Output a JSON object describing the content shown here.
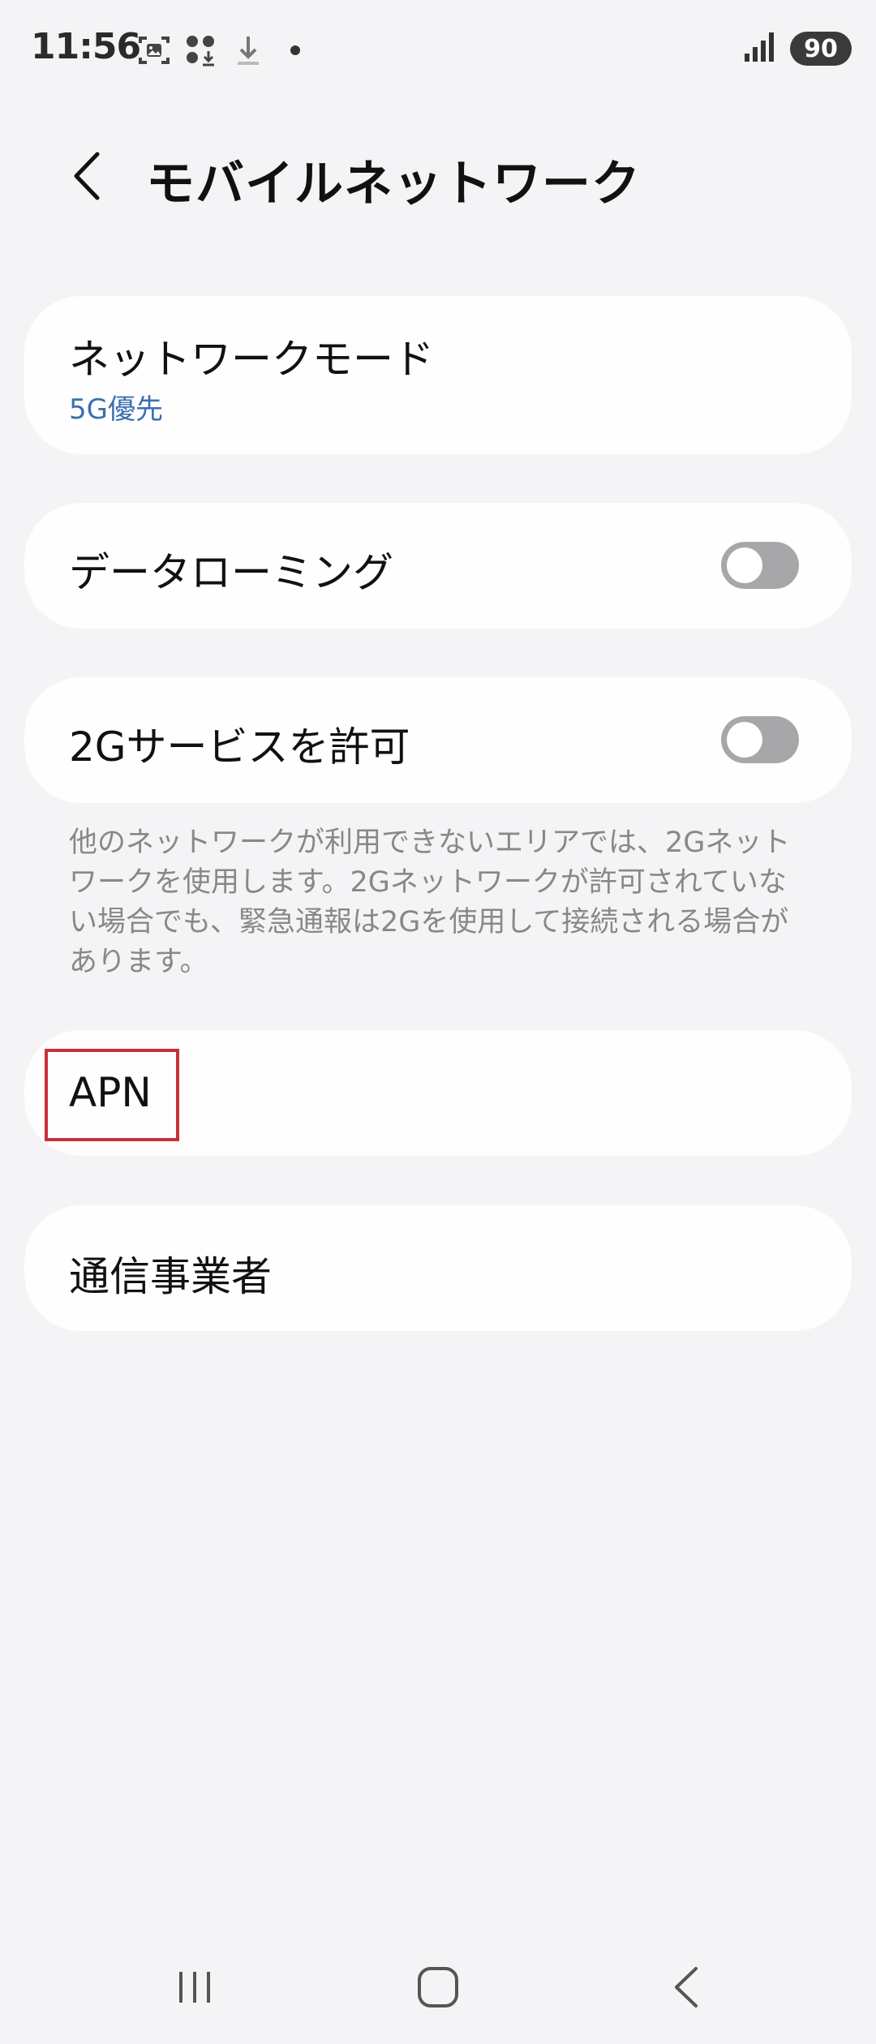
{
  "status_bar": {
    "time": "11:56",
    "battery": "90",
    "icons": [
      "screenshot-icon",
      "apps-download-icon",
      "download-icon",
      "dot-icon",
      "signal-icon",
      "battery-icon"
    ]
  },
  "header": {
    "title": "モバイルネットワーク",
    "back_icon": "chevron-left-icon"
  },
  "settings": {
    "network_mode": {
      "label": "ネットワークモード",
      "value": "5G優先"
    },
    "data_roaming": {
      "label": "データローミング",
      "enabled": false
    },
    "allow_2g": {
      "label": "2Gサービスを許可",
      "enabled": false
    },
    "description": "他のネットワークが利用できないエリアでは、2Gネットワークを使用します。2Gネットワークが許可されていない場合でも、緊急通報は2Gを使用して接続される場合があります。",
    "apn": {
      "label": "APN"
    },
    "carrier": {
      "label": "通信事業者"
    }
  },
  "colors": {
    "background": "#f4f4f6",
    "card": "#fefefe",
    "accent_text": "#3a6fb0",
    "toggle_off": "#a7a7a9",
    "highlight": "#c8303a"
  },
  "nav_bar": {
    "icons": [
      "recent-apps-icon",
      "home-icon",
      "back-icon"
    ]
  }
}
